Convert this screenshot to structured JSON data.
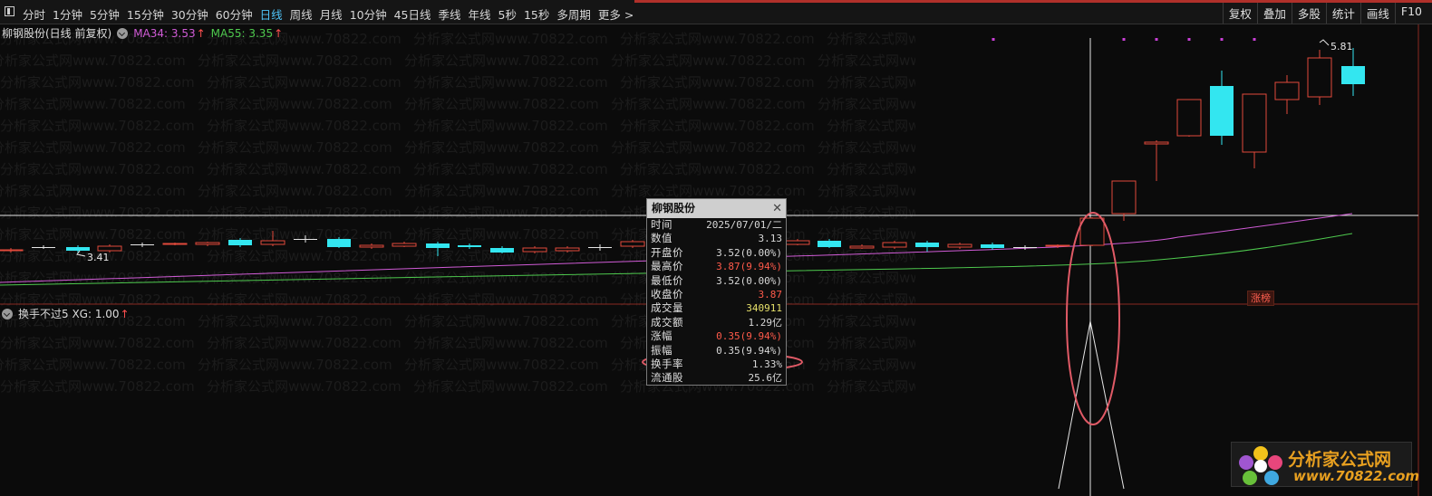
{
  "toolbar": {
    "periods": [
      "分时",
      "1分钟",
      "5分钟",
      "15分钟",
      "30分钟",
      "60分钟",
      "日线",
      "周线",
      "月线",
      "10分钟",
      "45日线",
      "季线",
      "年线",
      "5秒",
      "15秒",
      "多周期",
      "更多 >"
    ],
    "active_period": "日线",
    "right_buttons": [
      "复权",
      "叠加",
      "多股",
      "统计",
      "画线",
      "F10"
    ]
  },
  "main_panel": {
    "title": "柳钢股份(日线 前复权)",
    "ma34_label": "MA34: 3.53",
    "ma55_label": "MA55: 3.35",
    "arrow": "↑",
    "high_marker": "5.81",
    "low_marker": "3.41",
    "limit_up_badge": "涨榜"
  },
  "sub_panel": {
    "title": "换手不过5  XG: 1.00",
    "arrow": "↑"
  },
  "watermark": "分析家公式网www.70822.com",
  "tooltip": {
    "title": "柳钢股份",
    "rows": [
      {
        "label": "时间",
        "value": "2025/07/01/二",
        "color": "#d8d8d8"
      },
      {
        "label": "数值",
        "value": "3.13",
        "color": "#d8d8d8"
      },
      {
        "label": "开盘价",
        "value": "3.52(0.00%)",
        "color": "#d8d8d8"
      },
      {
        "label": "最高价",
        "value": "3.87(9.94%)",
        "color": "#ff5a4a"
      },
      {
        "label": "最低价",
        "value": "3.52(0.00%)",
        "color": "#d8d8d8"
      },
      {
        "label": "收盘价",
        "value": "3.87",
        "color": "#ff5a4a"
      },
      {
        "label": "成交量",
        "value": "340911",
        "color": "#e6e06a"
      },
      {
        "label": "成交额",
        "value": "1.29亿",
        "color": "#d8d8d8"
      },
      {
        "label": "涨幅",
        "value": "0.35(9.94%)",
        "color": "#ff5a4a"
      },
      {
        "label": "振幅",
        "value": "0.35(9.94%)",
        "color": "#d8d8d8"
      },
      {
        "label": "换手率",
        "value": "1.33%",
        "color": "#d8d8d8"
      },
      {
        "label": "流通股",
        "value": "25.6亿",
        "color": "#d8d8d8"
      }
    ]
  },
  "logo": {
    "name": "分析家公式网",
    "url": "www.70822.com"
  },
  "colors": {
    "up": "#e24a3b",
    "down": "#33e6f0",
    "ma34": "#d05bd6",
    "ma55": "#4ec94e",
    "annotation": "#e05a66"
  }
}
